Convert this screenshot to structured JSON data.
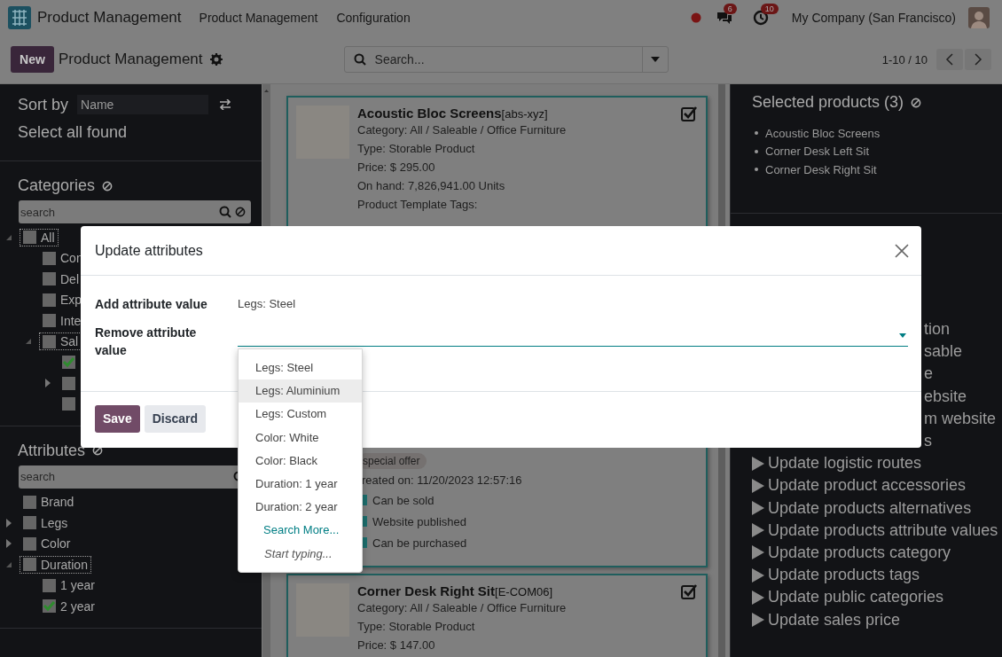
{
  "navbar": {
    "brand": "Product Management",
    "menus": [
      "Product Management",
      "Configuration"
    ],
    "messages_badge": "6",
    "activities_badge": "10",
    "company": "My Company (San Francisco)"
  },
  "control_panel": {
    "new_button": "New",
    "title": "Product Management",
    "search_placeholder": "Search...",
    "pager": "1-10 / 10"
  },
  "left_panel": {
    "sort_label": "Sort by",
    "sort_value": "Name",
    "select_all": "Select all found",
    "categories": {
      "title": "Categories",
      "search_placeholder": "search",
      "tree": [
        {
          "label": "All",
          "checked": false,
          "focused": true,
          "expanded": true,
          "children": [
            {
              "label": "Con",
              "checked": false,
              "focused": false
            },
            {
              "label": "Del",
              "checked": false,
              "focused": false
            },
            {
              "label": "Exp",
              "checked": false,
              "focused": false
            },
            {
              "label": "Inte",
              "checked": false,
              "focused": false
            },
            {
              "label": "Sal",
              "checked": false,
              "focused": true,
              "expanded": true,
              "children": [
                {
                  "checked": true,
                  "focused": false
                },
                {
                  "checked": false,
                  "focused": false,
                  "expanded": false
                },
                {
                  "checked": false,
                  "focused": false
                }
              ]
            }
          ]
        }
      ]
    },
    "attributes": {
      "title": "Attributes",
      "search_placeholder": "search",
      "tree": [
        {
          "label": "Brand",
          "checked": false,
          "focused": false
        },
        {
          "label": "Legs",
          "checked": false,
          "focused": false,
          "expanded": false
        },
        {
          "label": "Color",
          "checked": false,
          "focused": false,
          "expanded": false
        },
        {
          "label": "Duration",
          "checked": false,
          "focused": true,
          "expanded": true,
          "children": [
            {
              "label": "1 year",
              "checked": false,
              "focused": false
            },
            {
              "label": "2 year",
              "checked": true,
              "focused": false
            }
          ]
        }
      ]
    }
  },
  "products": [
    {
      "kind": "full",
      "selected": true,
      "name": "Acoustic Bloc Screens",
      "code": "[abs-xyz]",
      "lines": [
        "Category: All / Saleable / Office Furniture",
        "Type: Storable Product",
        "Price: $ 295.00",
        "On hand: 7,826,941.00 Units",
        "Product Template Tags:"
      ]
    },
    {
      "kind": "partial",
      "selected": true,
      "tags": [
        "special offer"
      ],
      "lines": [
        "reated on: 11/20/2023 12:57:16"
      ],
      "flags": [
        {
          "label": "Can be sold",
          "checked": true
        },
        {
          "label": "Website published",
          "checked": true
        },
        {
          "label": "Can be purchased",
          "checked": true
        }
      ]
    },
    {
      "kind": "full",
      "selected": true,
      "name": "Corner Desk Right Sit",
      "code": "[E-COM06]",
      "lines": [
        "Category: All / Saleable / Office Furniture",
        "Type: Storable Product",
        "Price: $ 147.00"
      ]
    }
  ],
  "selection_panel": {
    "title": "Selected products (3)",
    "products": [
      "Acoustic Bloc Screens",
      "Corner Desk Left Sit",
      "Corner Desk Right Sit"
    ],
    "actions": [
      {
        "kind": "fragment",
        "label": "tion"
      },
      {
        "kind": "fragment",
        "label": "sable"
      },
      {
        "kind": "fragment",
        "label": "e"
      },
      {
        "kind": "fragment",
        "label": "ebsite"
      },
      {
        "kind": "fragment",
        "label": "m website"
      },
      {
        "kind": "fragment",
        "label": "s"
      },
      {
        "kind": "action",
        "label": "Update logistic routes"
      },
      {
        "kind": "action",
        "label": "Update product accessories"
      },
      {
        "kind": "action",
        "label": "Update products alternatives"
      },
      {
        "kind": "action",
        "label": "Update products attribute values"
      },
      {
        "kind": "action",
        "label": "Update products category"
      },
      {
        "kind": "action",
        "label": "Update products tags"
      },
      {
        "kind": "action",
        "label": "Update public categories"
      },
      {
        "kind": "action",
        "label": "Update sales price"
      }
    ]
  },
  "dialog": {
    "title": "Update attributes",
    "fields": [
      {
        "kind": "text",
        "label": "Add attribute value",
        "value": "Legs: Steel"
      },
      {
        "kind": "select",
        "label": "Remove attribute value"
      }
    ],
    "buttons": [
      {
        "label": "Save",
        "primary": true
      },
      {
        "label": "Discard",
        "primary": false
      }
    ]
  },
  "dropdown": {
    "options": [
      {
        "label": "Legs: Steel",
        "selected": false
      },
      {
        "label": "Legs: Aluminium",
        "selected": true
      },
      {
        "label": "Legs: Custom",
        "selected": false
      },
      {
        "label": "Color: White",
        "selected": false
      },
      {
        "label": "Color: Black",
        "selected": false
      },
      {
        "label": "Duration: 1 year",
        "selected": false
      },
      {
        "label": "Duration: 2 year",
        "selected": false
      }
    ],
    "search_more": "Search More...",
    "hint": "Start typing..."
  }
}
